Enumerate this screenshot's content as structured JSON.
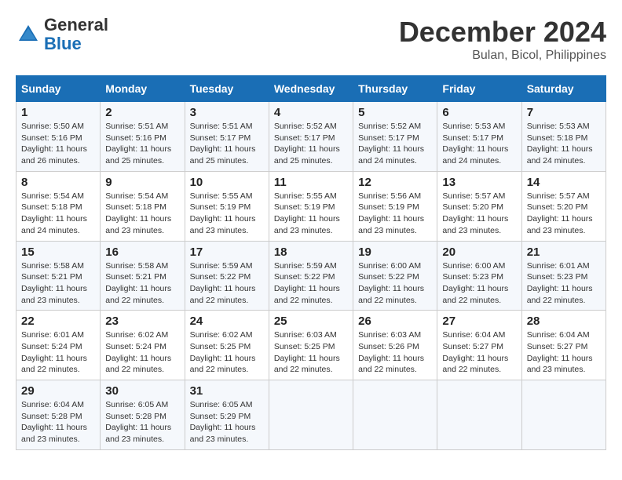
{
  "header": {
    "logo_text_general": "General",
    "logo_text_blue": "Blue",
    "main_title": "December 2024",
    "subtitle": "Bulan, Bicol, Philippines"
  },
  "calendar": {
    "days_of_week": [
      "Sunday",
      "Monday",
      "Tuesday",
      "Wednesday",
      "Thursday",
      "Friday",
      "Saturday"
    ],
    "weeks": [
      [
        null,
        null,
        null,
        null,
        null,
        null,
        null
      ]
    ]
  },
  "cells": {
    "empty": "",
    "w1": [
      {
        "day": "1",
        "rise": "5:50 AM",
        "set": "5:16 PM",
        "daylight": "11 hours and 26 minutes."
      },
      {
        "day": "2",
        "rise": "5:51 AM",
        "set": "5:16 PM",
        "daylight": "11 hours and 25 minutes."
      },
      {
        "day": "3",
        "rise": "5:51 AM",
        "set": "5:17 PM",
        "daylight": "11 hours and 25 minutes."
      },
      {
        "day": "4",
        "rise": "5:52 AM",
        "set": "5:17 PM",
        "daylight": "11 hours and 25 minutes."
      },
      {
        "day": "5",
        "rise": "5:52 AM",
        "set": "5:17 PM",
        "daylight": "11 hours and 24 minutes."
      },
      {
        "day": "6",
        "rise": "5:53 AM",
        "set": "5:17 PM",
        "daylight": "11 hours and 24 minutes."
      },
      {
        "day": "7",
        "rise": "5:53 AM",
        "set": "5:18 PM",
        "daylight": "11 hours and 24 minutes."
      }
    ],
    "w2": [
      {
        "day": "8",
        "rise": "5:54 AM",
        "set": "5:18 PM",
        "daylight": "11 hours and 24 minutes."
      },
      {
        "day": "9",
        "rise": "5:54 AM",
        "set": "5:18 PM",
        "daylight": "11 hours and 23 minutes."
      },
      {
        "day": "10",
        "rise": "5:55 AM",
        "set": "5:19 PM",
        "daylight": "11 hours and 23 minutes."
      },
      {
        "day": "11",
        "rise": "5:55 AM",
        "set": "5:19 PM",
        "daylight": "11 hours and 23 minutes."
      },
      {
        "day": "12",
        "rise": "5:56 AM",
        "set": "5:19 PM",
        "daylight": "11 hours and 23 minutes."
      },
      {
        "day": "13",
        "rise": "5:57 AM",
        "set": "5:20 PM",
        "daylight": "11 hours and 23 minutes."
      },
      {
        "day": "14",
        "rise": "5:57 AM",
        "set": "5:20 PM",
        "daylight": "11 hours and 23 minutes."
      }
    ],
    "w3": [
      {
        "day": "15",
        "rise": "5:58 AM",
        "set": "5:21 PM",
        "daylight": "11 hours and 23 minutes."
      },
      {
        "day": "16",
        "rise": "5:58 AM",
        "set": "5:21 PM",
        "daylight": "11 hours and 22 minutes."
      },
      {
        "day": "17",
        "rise": "5:59 AM",
        "set": "5:22 PM",
        "daylight": "11 hours and 22 minutes."
      },
      {
        "day": "18",
        "rise": "5:59 AM",
        "set": "5:22 PM",
        "daylight": "11 hours and 22 minutes."
      },
      {
        "day": "19",
        "rise": "6:00 AM",
        "set": "5:22 PM",
        "daylight": "11 hours and 22 minutes."
      },
      {
        "day": "20",
        "rise": "6:00 AM",
        "set": "5:23 PM",
        "daylight": "11 hours and 22 minutes."
      },
      {
        "day": "21",
        "rise": "6:01 AM",
        "set": "5:23 PM",
        "daylight": "11 hours and 22 minutes."
      }
    ],
    "w4": [
      {
        "day": "22",
        "rise": "6:01 AM",
        "set": "5:24 PM",
        "daylight": "11 hours and 22 minutes."
      },
      {
        "day": "23",
        "rise": "6:02 AM",
        "set": "5:24 PM",
        "daylight": "11 hours and 22 minutes."
      },
      {
        "day": "24",
        "rise": "6:02 AM",
        "set": "5:25 PM",
        "daylight": "11 hours and 22 minutes."
      },
      {
        "day": "25",
        "rise": "6:03 AM",
        "set": "5:25 PM",
        "daylight": "11 hours and 22 minutes."
      },
      {
        "day": "26",
        "rise": "6:03 AM",
        "set": "5:26 PM",
        "daylight": "11 hours and 22 minutes."
      },
      {
        "day": "27",
        "rise": "6:04 AM",
        "set": "5:27 PM",
        "daylight": "11 hours and 22 minutes."
      },
      {
        "day": "28",
        "rise": "6:04 AM",
        "set": "5:27 PM",
        "daylight": "11 hours and 23 minutes."
      }
    ],
    "w5": [
      {
        "day": "29",
        "rise": "6:04 AM",
        "set": "5:28 PM",
        "daylight": "11 hours and 23 minutes."
      },
      {
        "day": "30",
        "rise": "6:05 AM",
        "set": "5:28 PM",
        "daylight": "11 hours and 23 minutes."
      },
      {
        "day": "31",
        "rise": "6:05 AM",
        "set": "5:29 PM",
        "daylight": "11 hours and 23 minutes."
      }
    ]
  },
  "labels": {
    "sunrise": "Sunrise:",
    "sunset": "Sunset:",
    "daylight": "Daylight:"
  }
}
